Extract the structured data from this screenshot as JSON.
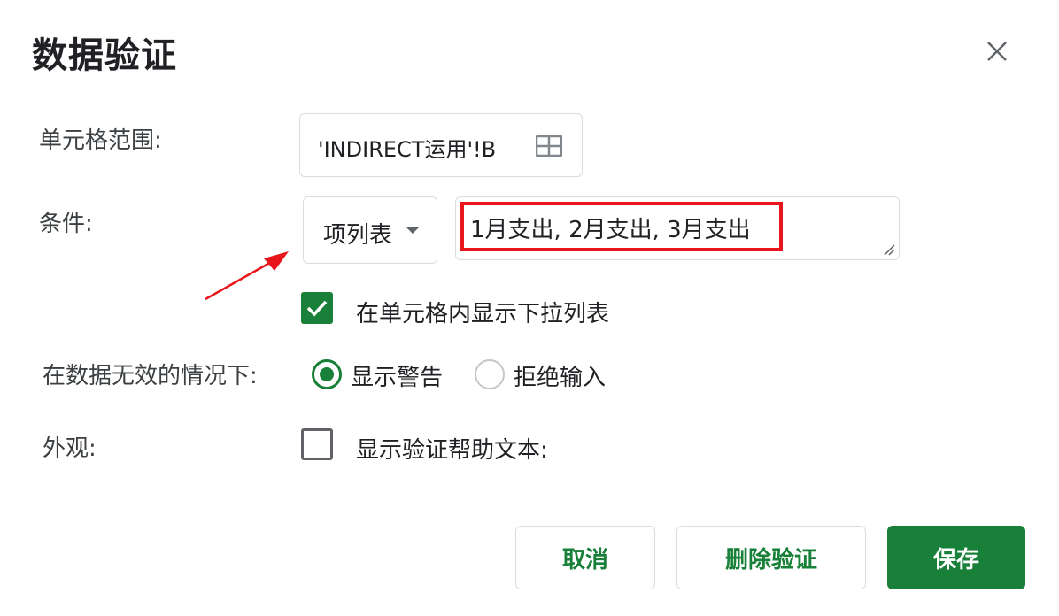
{
  "dialog": {
    "title": "数据验证",
    "close_icon": "close-icon"
  },
  "range": {
    "label": "单元格范围:",
    "value": "'INDIRECT运用'!B",
    "icon": "grid-select-icon"
  },
  "condition": {
    "label": "条件:",
    "type": "项列表",
    "value": "1月支出, 2月支出, 3月支出",
    "highlight_color": "#e8151b",
    "annotation_arrow_color": "#e8151b"
  },
  "dropdown_option": {
    "label": "在单元格内显示下拉列表",
    "checked": true
  },
  "invalid_data": {
    "label": "在数据无效的情况下:",
    "options": [
      {
        "label": "显示警告",
        "selected": true
      },
      {
        "label": "拒绝输入",
        "selected": false
      }
    ]
  },
  "appearance": {
    "label": "外观:",
    "help_text_option": "显示验证帮助文本:",
    "checked": false
  },
  "buttons": {
    "cancel": "取消",
    "remove": "删除验证",
    "save": "保存"
  },
  "colors": {
    "accent": "#188038",
    "text": "#202124",
    "secondary_text": "#3c4043",
    "border": "#dadce0",
    "annotation_red": "#e8151b"
  }
}
